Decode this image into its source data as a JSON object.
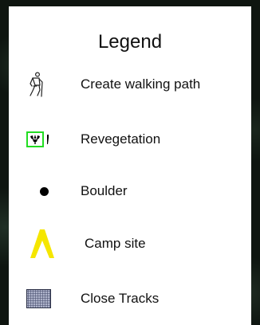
{
  "legend": {
    "title": "Legend",
    "items": [
      {
        "icon": "hiker-icon",
        "label": "Create walking path"
      },
      {
        "icon": "revegetation-icon",
        "label": "Revegetation",
        "color": "#22dd22"
      },
      {
        "icon": "boulder-icon",
        "label": "Boulder",
        "color": "#000000"
      },
      {
        "icon": "camp-site-icon",
        "label": "Camp site",
        "color": "#f5e600"
      },
      {
        "icon": "close-tracks-swatch",
        "label": "Close Tracks",
        "color": "#8e94b0"
      }
    ]
  }
}
